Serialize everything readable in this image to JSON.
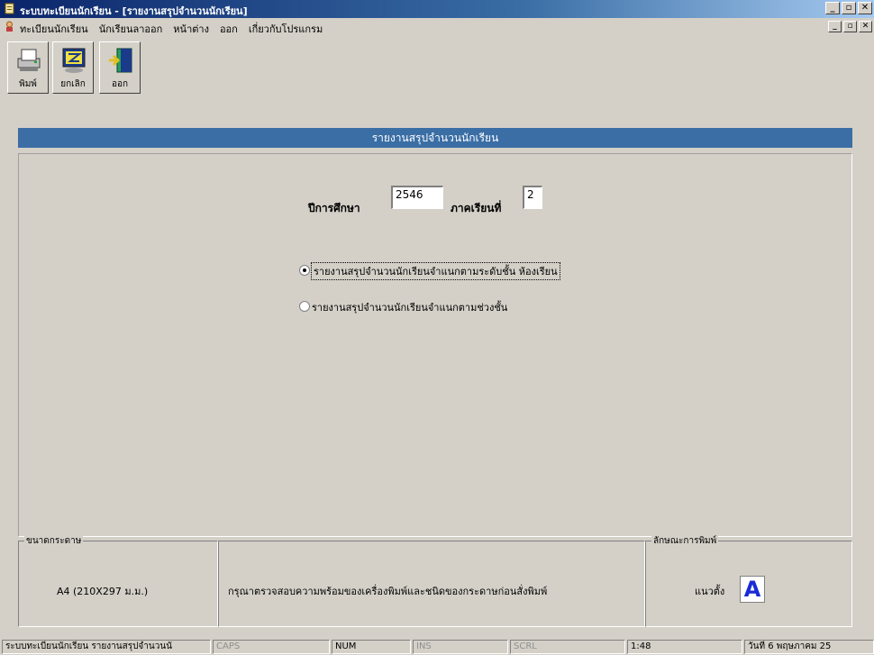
{
  "window": {
    "title": "ระบบทะเบียนนักเรียน - [รายงานสรุปจำนวนนักเรียน]"
  },
  "menu": {
    "items": [
      "ทะเบียนนักเรียน",
      "นักเรียนลาออก",
      "หน้าต่าง",
      "ออก",
      "เกี่ยวกับโปรแกรม"
    ]
  },
  "toolbar": {
    "print_label": "พิมพ์",
    "cancel_label": "ยกเลิก",
    "exit_label": "ออก"
  },
  "banner": {
    "title": "รายงานสรุปจำนวนนักเรียน"
  },
  "form": {
    "year_label": "ปีการศึกษา",
    "year_value": "2546",
    "term_label": "ภาคเรียนที่",
    "term_value": "2",
    "option1": "รายงานสรุปจำนวนนักเรียนจำแนกตามระดับชั้น ห้องเรียน",
    "option2": "รายงานสรุปจำนวนนักเรียนจำแนกตามช่วงชั้น",
    "selected": 1
  },
  "paper": {
    "title": "ขนาดกระดาษ",
    "value": "A4 (210X297 ม.ม.)"
  },
  "note": {
    "text": "กรุณาตรวจสอบความพร้อมของเครื่องพิมพ์และชนิดของกระดาษก่อนสั่งพิมพ์"
  },
  "orientation": {
    "title": "ลักษณะการพิมพ์",
    "value": "แนวตั้ง",
    "icon_letter": "A"
  },
  "status": {
    "text": "ระบบทะเบียนนักเรียน รายงานสรุปจำนวนนั",
    "caps": "CAPS",
    "num": "NUM",
    "ins": "INS",
    "scrl": "SCRL",
    "time": "1:48",
    "date": "วันที่ 6 พฤษภาคม 25"
  },
  "colors": {
    "banner": "#3a6ea5",
    "titlebar": "#0a246a",
    "face": "#d4d0c8"
  }
}
